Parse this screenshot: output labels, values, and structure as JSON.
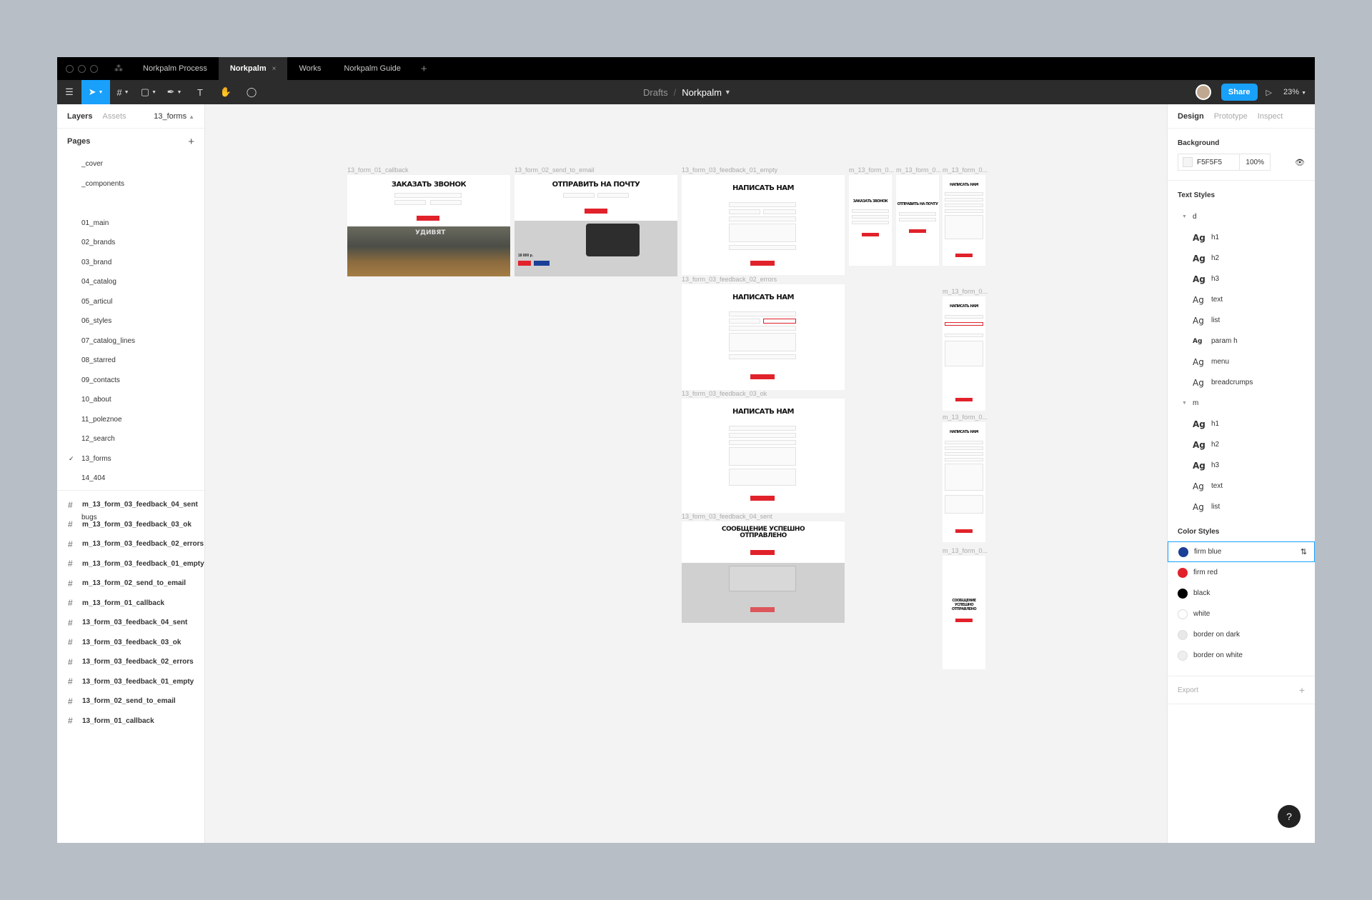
{
  "tabs": [
    {
      "label": "Norkpalm Process",
      "active": false
    },
    {
      "label": "Norkpalm",
      "active": true,
      "close": "×"
    },
    {
      "label": "Works",
      "active": false
    },
    {
      "label": "Norkpalm Guide",
      "active": false
    }
  ],
  "tab_add": "+",
  "breadcrumb": {
    "folder": "Drafts",
    "separator": "/",
    "file": "Norkpalm"
  },
  "toolbar": {
    "share": "Share",
    "zoom": "23%"
  },
  "left_panel": {
    "tab_layers": "Layers",
    "tab_assets": "Assets",
    "current_page": "13_forms",
    "pages_title": "Pages",
    "pages_add": "+",
    "pages": [
      "_cover",
      "_components",
      "",
      "01_main",
      "02_brands",
      "03_brand",
      "04_catalog",
      "05_articul",
      "06_styles",
      "07_catalog_lines",
      "08_starred",
      "09_contacts",
      "10_about",
      "11_poleznoe",
      "12_search",
      "13_forms",
      "14_404",
      "",
      "bugs"
    ],
    "selected_page": "13_forms",
    "layers": [
      "m_13_form_03_feedback_04_sent",
      "m_13_form_03_feedback_03_ok",
      "m_13_form_03_feedback_02_errors",
      "m_13_form_03_feedback_01_empty",
      "m_13_form_02_send_to_email",
      "m_13_form_01_callback",
      "13_form_03_feedback_04_sent",
      "13_form_03_feedback_03_ok",
      "13_form_03_feedback_02_errors",
      "13_form_03_feedback_01_empty",
      "13_form_02_send_to_email",
      "13_form_01_callback"
    ]
  },
  "right_panel": {
    "tab_design": "Design",
    "tab_prototype": "Prototype",
    "tab_inspect": "Inspect",
    "background_title": "Background",
    "background_hex": "F5F5F5",
    "background_opacity": "100%",
    "text_styles_title": "Text Styles",
    "text_style_groups": [
      {
        "name": "d",
        "styles": [
          {
            "ag": "Ag",
            "name": "h1"
          },
          {
            "ag": "Ag",
            "name": "h2"
          },
          {
            "ag": "Ag",
            "name": "h3"
          },
          {
            "ag": "Ag",
            "name": "text"
          },
          {
            "ag": "Ag",
            "name": "list"
          },
          {
            "ag": "Ag",
            "name": "param h"
          },
          {
            "ag": "Ag",
            "name": "menu"
          },
          {
            "ag": "Ag",
            "name": "breadcrumps"
          }
        ]
      },
      {
        "name": "m",
        "styles": [
          {
            "ag": "Ag",
            "name": "h1"
          },
          {
            "ag": "Ag",
            "name": "h2"
          },
          {
            "ag": "Ag",
            "name": "h3"
          },
          {
            "ag": "Ag",
            "name": "text"
          },
          {
            "ag": "Ag",
            "name": "list"
          }
        ]
      }
    ],
    "color_styles_title": "Color Styles",
    "color_styles": [
      {
        "name": "firm blue",
        "color": "#1b3f97"
      },
      {
        "name": "firm red",
        "color": "#e1222b"
      },
      {
        "name": "black",
        "color": "#000000"
      },
      {
        "name": "white",
        "color": "#ffffff"
      },
      {
        "name": "border on dark",
        "color": "#e8e8e8"
      },
      {
        "name": "border on white",
        "color": "#eeeeee"
      }
    ],
    "export_title": "Export",
    "export_add": "+"
  },
  "help": "?",
  "canvas": {
    "frames": [
      {
        "label": "13_form_01_callback",
        "title": "ЗАКАЗАТЬ ЗВОНОК"
      },
      {
        "label": "13_form_02_send_to_email",
        "title": "ОТПРАВИТЬ НА ПОЧТУ"
      },
      {
        "label": "13_form_03_feedback_01_empty",
        "title": "НАПИСАТЬ НАМ"
      },
      {
        "label": "13_form_03_feedback_02_errors",
        "title": "НАПИСАТЬ НАМ"
      },
      {
        "label": "13_form_03_feedback_03_ok",
        "title": "НАПИСАТЬ НАМ"
      },
      {
        "label": "13_form_03_feedback_04_sent",
        "title": "СООБЩЕНИЕ УСПЕШНО ОТПРАВЛЕНО"
      },
      {
        "label": "m_13_form_0...",
        "title": "ЗАКАЗАТЬ ЗВОНОК"
      },
      {
        "label": "m_13_form_0...",
        "title": "ОТПРАВИТЬ НА ПОЧТУ"
      },
      {
        "label": "m_13_form_0...",
        "title": "НАПИСАТЬ НАМ"
      },
      {
        "label": "m_13_form_0...",
        "title": "НАПИСАТЬ НАМ"
      },
      {
        "label": "m_13_form_0...",
        "title": "НАПИСАТЬ НАМ"
      },
      {
        "label": "m_13_form_0...",
        "title": "СООБЩЕНИЕ УСПЕШНО ОТПРАВЛЕНО"
      }
    ],
    "photo_text": "УДИВЯТ",
    "price_text": "18 800 р."
  }
}
